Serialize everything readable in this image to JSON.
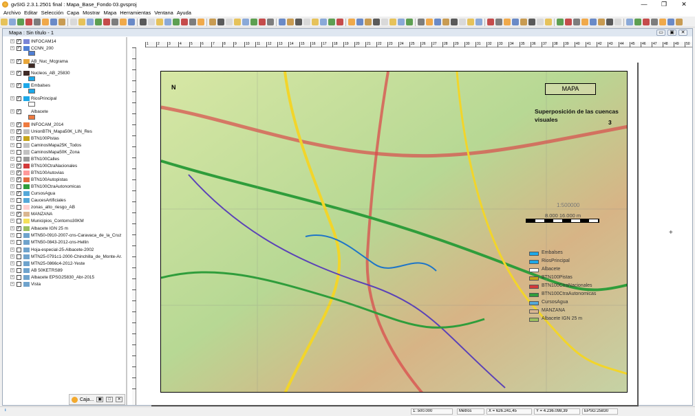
{
  "window": {
    "title": "gvSIG 2.3.1.2501 final : Mapa_Base_Fondo 03.gvsproj",
    "controls": [
      "—",
      "❐",
      "✕"
    ]
  },
  "menu": [
    "Archivo",
    "Editar",
    "Selección",
    "Capa",
    "Mostrar",
    "Mapa",
    "Herramientas",
    "Ventana",
    "Ayuda"
  ],
  "document": {
    "title": "Mapa : Sin título - 1",
    "buttons": [
      "▭",
      "▣",
      "✕"
    ]
  },
  "toc": {
    "layers": [
      {
        "name": "INFOCAM14",
        "checked": true,
        "color": "#7a85d6"
      },
      {
        "name": "CCNN_200",
        "checked": true,
        "color": "#4f7fd4"
      },
      {
        "name": "AB_Nuc_Mcgrama",
        "checked": true,
        "color": "#e7a63a"
      },
      {
        "name": "Nucleos_AB_25830",
        "checked": true,
        "color": "#3f2a26"
      },
      {
        "name": "Embalses",
        "checked": true,
        "color": "#1da8e8"
      },
      {
        "name": "RiosPrincipal",
        "checked": true,
        "color": "#1da8e8"
      },
      {
        "name": "Albacete",
        "checked": true,
        "color": "#ffffff"
      },
      {
        "name": "INFOCAM_2014",
        "checked": true,
        "color": "#ee7a3f"
      },
      {
        "name": "UnionBTN_Mapa50K_LIN_Res",
        "checked": true,
        "color": "#bdbdbd"
      },
      {
        "name": "BTN100Pistas",
        "checked": true,
        "color": "#c6a41a"
      },
      {
        "name": "CaminosMapa25K_Todos",
        "checked": false,
        "color": "#c2c2c2"
      },
      {
        "name": "CaminosMapa50K_Zona",
        "checked": false,
        "color": "#c2c2c2"
      },
      {
        "name": "BTN100Calles",
        "checked": false,
        "color": "#9b9b9b"
      },
      {
        "name": "BTN100CtraNacionales",
        "checked": true,
        "color": "#d33a3a"
      },
      {
        "name": "BTN100Autovias",
        "checked": true,
        "color": "#ff9a9a"
      },
      {
        "name": "BTN100Autopistas",
        "checked": true,
        "color": "#e36b3f"
      },
      {
        "name": "BTN100CtraAutonomicas",
        "checked": false,
        "color": "#2f9d3b"
      },
      {
        "name": "CursosAgua",
        "checked": true,
        "color": "#55a8d8"
      },
      {
        "name": "CaucesArtificiales",
        "checked": false,
        "color": "#55a8d8"
      },
      {
        "name": "zonas_alto_riesgo_AB",
        "checked": false,
        "color": "#ffd0d0"
      },
      {
        "name": "MANZANA",
        "checked": true,
        "color": "#d9b690"
      },
      {
        "name": "Municipios_Contorno30KM",
        "checked": false,
        "color": "#f4e05a"
      },
      {
        "name": "Albacete IGN 25 m",
        "checked": true,
        "color": "#9bbf61"
      },
      {
        "name": "MTN50-0910-2007-cns-Caravaca_de_la_Cruz",
        "checked": false,
        "color": "#6fa3cc"
      },
      {
        "name": "MTN50-0843-2012-cns-Hellin",
        "checked": false,
        "color": "#6fa3cc"
      },
      {
        "name": "Hoja-especial-25-Albacete-2002",
        "checked": false,
        "color": "#6fa3cc"
      },
      {
        "name": "MTN25-0791c1-2000-Chinchilla_de_Monte-Ar.",
        "checked": false,
        "color": "#6fa3cc"
      },
      {
        "name": "MTN25-0866c4-2012-Yeste",
        "checked": false,
        "color": "#6fa3cc"
      },
      {
        "name": "AB 50KETRS89",
        "checked": false,
        "color": "#6fa3cc"
      },
      {
        "name": "Albacete EPSG25830_Abr-2015",
        "checked": false,
        "color": "#6fa3cc"
      },
      {
        "name": "Vista",
        "checked": false,
        "color": "#6fa3cc"
      }
    ]
  },
  "layout": {
    "map_title": "MAPA",
    "map_subtitle": "Superposición de las cuencas visuales",
    "map_number": "3",
    "scale_text": "1:500000",
    "scale_labels": "8.000  16.000 m",
    "north": "N",
    "legend": [
      {
        "label": "Embalses",
        "color": "#1da8e8"
      },
      {
        "label": "RiosPrincipal",
        "color": "#1da8e8"
      },
      {
        "label": "Albacete",
        "color": "#fff"
      },
      {
        "label": "BTN100Pistas",
        "color": "#c6a41a"
      },
      {
        "label": "BTN100CtraNacionales",
        "color": "#d33a3a"
      },
      {
        "label": "BTN100CtraAutonomicas",
        "color": "#2f9d3b"
      },
      {
        "label": "CursosAgua",
        "color": "#55a8d8"
      },
      {
        "label": "MANZANA",
        "color": "#d9b690"
      },
      {
        "label": "Albacete IGN 25 m",
        "color": "#9bbf61"
      }
    ]
  },
  "minimized": {
    "title": "Caja..."
  },
  "status": {
    "info_icon": "i",
    "scale": "1: 500.000",
    "units": "Metros",
    "x": "X = 626.241,45",
    "y": "Y = 4.236.098,39",
    "epsg": "EPSG:25830"
  }
}
